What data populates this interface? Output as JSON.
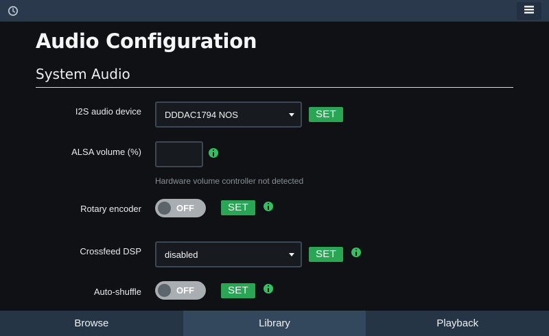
{
  "topbar": {
    "clock_icon": "clock-icon",
    "menu_icon": "hamburger-menu-icon"
  },
  "page": {
    "title": "Audio Configuration",
    "section_title": "System Audio"
  },
  "settings": {
    "i2s_device": {
      "label": "I2S audio device",
      "value": "DDDAC1794 NOS",
      "button": "SET"
    },
    "alsa_volume": {
      "label": "ALSA volume (%)",
      "value": "",
      "help": "Hardware volume controller not detected"
    },
    "rotary_encoder": {
      "label": "Rotary encoder",
      "state": "OFF",
      "button": "SET"
    },
    "crossfeed_dsp": {
      "label": "Crossfeed DSP",
      "value": "disabled",
      "button": "SET"
    },
    "auto_shuffle": {
      "label": "Auto-shuffle",
      "state": "OFF",
      "button": "SET"
    }
  },
  "bottom_nav": {
    "items": [
      {
        "label": "Browse"
      },
      {
        "label": "Library"
      },
      {
        "label": "Playback"
      }
    ],
    "active": "Library"
  },
  "colors": {
    "background": "#0f1114",
    "topbar": "#2a3a4c",
    "set_button": "#28a653",
    "info_icon": "#2ec261",
    "toggle_off": "#a9aeb2",
    "nav_bar": "#263545",
    "nav_active": "#33485c"
  }
}
